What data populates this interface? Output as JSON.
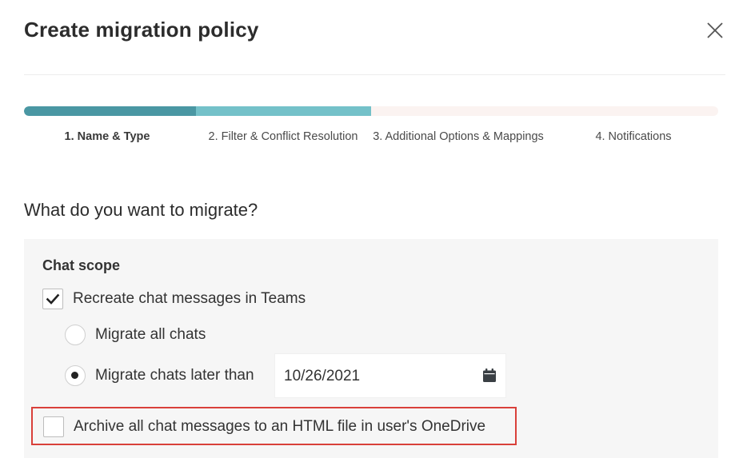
{
  "dialog": {
    "title": "Create migration policy",
    "close_icon": "close-icon"
  },
  "stepper": {
    "steps": [
      {
        "label": "1. Name & Type",
        "state": "current"
      },
      {
        "label": "2. Filter & Conflict Resolution",
        "state": "upcoming"
      },
      {
        "label": "3. Additional Options & Mappings",
        "state": "upcoming"
      },
      {
        "label": "4. Notifications",
        "state": "upcoming"
      }
    ],
    "progress_fraction": 0.5,
    "colors": {
      "done": "#4a97a3",
      "current": "#74c1c9",
      "remaining": "#fbf3f1"
    }
  },
  "section": {
    "heading": "What do you want to migrate?"
  },
  "chat_scope": {
    "title": "Chat scope",
    "recreate": {
      "label": "Recreate chat messages in Teams",
      "checked": true
    },
    "options": [
      {
        "label": "Migrate all chats",
        "selected": false
      },
      {
        "label": "Migrate chats later than",
        "selected": true
      }
    ],
    "date": {
      "value": "10/26/2021",
      "icon": "calendar-icon"
    },
    "archive": {
      "label": "Archive all chat messages to an HTML file in user's OneDrive",
      "checked": false
    },
    "highlight_color": "#d9403a"
  }
}
